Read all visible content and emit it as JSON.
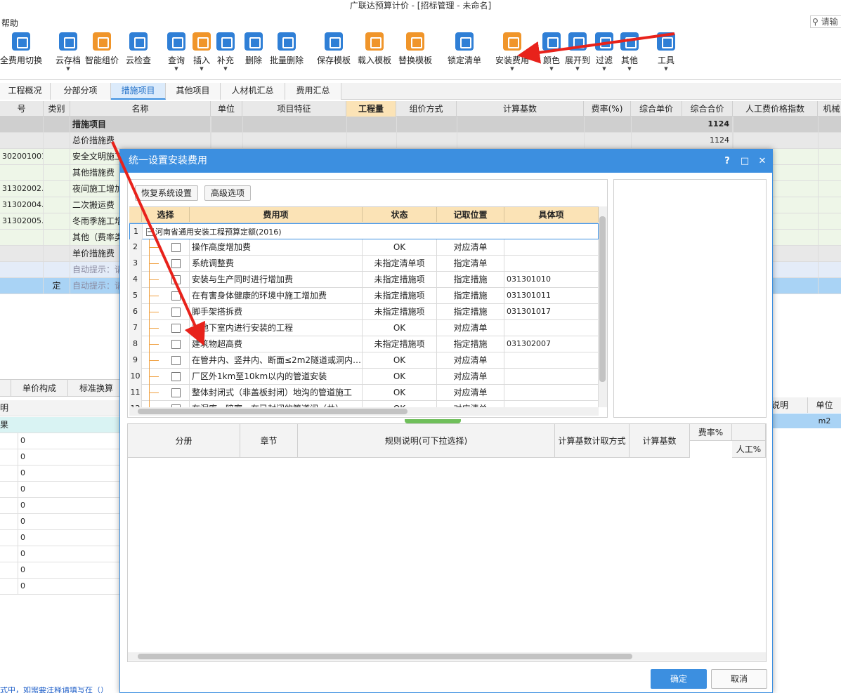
{
  "app": {
    "title": "广联达预算计价 - [招标管理 - 未命名]",
    "search_placeholder": "请输",
    "menu_help": "帮助"
  },
  "ribbon": {
    "buttons": [
      {
        "label": "全费用切换",
        "icon": "switch-cost-icon"
      },
      {
        "label": "云存档",
        "icon": "cloud-save-icon"
      },
      {
        "label": "智能组价",
        "icon": "smart-price-icon"
      },
      {
        "label": "云检查",
        "icon": "cloud-check-icon"
      },
      {
        "label": "查询",
        "icon": "query-icon"
      },
      {
        "label": "插入",
        "icon": "insert-icon"
      },
      {
        "label": "补充",
        "icon": "supplement-icon"
      },
      {
        "label": "删除",
        "icon": "delete-icon"
      },
      {
        "label": "批量删除",
        "icon": "batch-delete-icon"
      },
      {
        "label": "保存模板",
        "icon": "save-template-icon"
      },
      {
        "label": "载入模板",
        "icon": "load-template-icon"
      },
      {
        "label": "替换模板",
        "icon": "replace-template-icon"
      },
      {
        "label": "锁定清单",
        "icon": "lock-icon"
      },
      {
        "label": "安装费用",
        "icon": "install-cost-icon"
      },
      {
        "label": "颜色",
        "icon": "color-icon"
      },
      {
        "label": "展开到",
        "icon": "expand-icon"
      },
      {
        "label": "过滤",
        "icon": "filter-icon"
      },
      {
        "label": "其他",
        "icon": "other-icon"
      },
      {
        "label": "工具",
        "icon": "tools-icon"
      }
    ]
  },
  "tabs": [
    "工程概况",
    "分部分项",
    "措施项目",
    "其他项目",
    "人材机汇总",
    "费用汇总"
  ],
  "main_table": {
    "headers": [
      "号",
      "类别",
      "名称",
      "单位",
      "项目特征",
      "工程量",
      "组价方式",
      "计算基数",
      "费率(%)",
      "综合单价",
      "综合合价",
      "人工费价格指数",
      "机械"
    ],
    "rows": [
      {
        "code": "",
        "type": "",
        "name": "措施项目",
        "total": "1124"
      },
      {
        "code": "",
        "type": "",
        "name": "总价措施费",
        "total": "1124"
      },
      {
        "code": "302001001",
        "type": "",
        "name": "安全文明施工",
        "total": ""
      },
      {
        "code": "",
        "type": "",
        "name": "其他措施费（",
        "total": ""
      },
      {
        "code": "31302002…",
        "type": "",
        "name": "夜间施工增加",
        "total": ""
      },
      {
        "code": "31302004…",
        "type": "",
        "name": "二次搬运费",
        "total": ""
      },
      {
        "code": "31302005…",
        "type": "",
        "name": "冬雨季施工增",
        "total": ""
      },
      {
        "code": "",
        "type": "",
        "name": "其他（费率类",
        "total": ""
      },
      {
        "code": "",
        "type": "",
        "name": "单价措施费",
        "total": ""
      },
      {
        "code": "",
        "type": "",
        "name": "自动提示：请",
        "total": ""
      },
      {
        "code": "",
        "type": "定",
        "name": "自动提示：请",
        "total": ""
      }
    ]
  },
  "bottom_panel": {
    "tabs": [
      "单价构成",
      "标准换算"
    ],
    "header": "明",
    "row1": "果",
    "values": [
      "0",
      "0",
      "0",
      "0",
      "0",
      "0",
      "0",
      "0",
      "0",
      "0"
    ],
    "right_headers": [
      "说明",
      "单位"
    ],
    "right_unit": "m2",
    "footer_hint": "式中，如需要注释请填写在（）"
  },
  "dialog": {
    "title": "统一设置安装费用",
    "controls": [
      "?",
      "□",
      "✕"
    ],
    "buttons": {
      "restore": "恢复系统设置",
      "advanced": "高级选项",
      "ok": "确定",
      "cancel": "取消"
    },
    "grid_headers": [
      "选择",
      "费用项",
      "状态",
      "记取位置",
      "具体项"
    ],
    "rows": [
      {
        "no": "1",
        "name": "河南省通用安装工程预算定额(2016)",
        "status": "",
        "pos": "",
        "item": "",
        "group": true
      },
      {
        "no": "2",
        "name": "操作高度增加费",
        "status": "OK",
        "pos": "对应清单",
        "item": ""
      },
      {
        "no": "3",
        "name": "系统调整费",
        "status": "未指定清单项",
        "pos": "指定清单",
        "item": ""
      },
      {
        "no": "4",
        "name": "安装与生产同时进行增加费",
        "status": "未指定措施项",
        "pos": "指定措施",
        "item": "031301010"
      },
      {
        "no": "5",
        "name": "在有害身体健康的环境中施工增加费",
        "status": "未指定措施项",
        "pos": "指定措施",
        "item": "031301011"
      },
      {
        "no": "6",
        "name": "脚手架搭拆费",
        "status": "未指定措施项",
        "pos": "指定措施",
        "item": "031301017"
      },
      {
        "no": "7",
        "name": "在地下室内进行安装的工程",
        "status": "OK",
        "pos": "对应清单",
        "item": ""
      },
      {
        "no": "8",
        "name": "建筑物超高费",
        "status": "未指定措施项",
        "pos": "指定措施",
        "item": "031302007"
      },
      {
        "no": "9",
        "name": "在管井内、竖井内、断面≤2m2隧道或洞内…",
        "status": "OK",
        "pos": "对应清单",
        "item": ""
      },
      {
        "no": "10",
        "name": "厂区外1km至10km以内的管道安装",
        "status": "OK",
        "pos": "对应清单",
        "item": ""
      },
      {
        "no": "11",
        "name": "整体封闭式（非盖板封闭）地沟的管道施工",
        "status": "OK",
        "pos": "对应清单",
        "item": ""
      },
      {
        "no": "12",
        "name": "在洞库、暗室，在已封闭的管道间（井）…",
        "status": "OK",
        "pos": "对应清单",
        "item": ""
      }
    ],
    "lower_headers": [
      "分册",
      "章节",
      "规则说明(可下拉选择)",
      "计算基数计取方式",
      "计算基数",
      "费率%",
      "人工%"
    ]
  },
  "colors": {
    "accent": "#3c8fe0",
    "header": "#fbe3b6",
    "arrow": "#e8221b"
  }
}
